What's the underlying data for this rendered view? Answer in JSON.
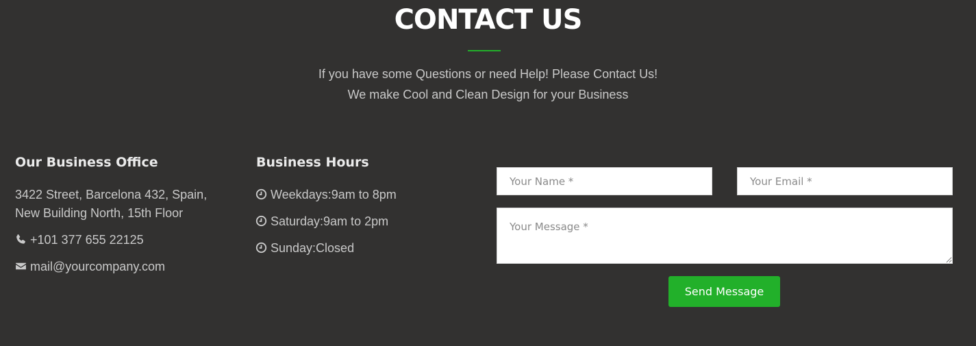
{
  "header": {
    "title": "CONTACT US",
    "subtitle_line1": "If you have some Questions or need Help! Please Contact Us!",
    "subtitle_line2": "We make Cool and Clean Design for your Business"
  },
  "office": {
    "heading": "Our Business Office",
    "address_line1": "3422 Street, Barcelona 432, Spain,",
    "address_line2": "New Building North, 15th Floor",
    "phone": "+101 377 655 22125",
    "email": "mail@yourcompany.com",
    "phone_icon": "phone-icon",
    "email_icon": "envelope-icon"
  },
  "hours": {
    "heading": "Business Hours",
    "items": [
      {
        "label": "Weekdays:9am to 8pm",
        "icon": "clock-icon"
      },
      {
        "label": "Saturday:9am to 2pm",
        "icon": "clock-icon"
      },
      {
        "label": "Sunday:Closed",
        "icon": "clock-icon"
      }
    ]
  },
  "form": {
    "name_placeholder": "Your Name *",
    "email_placeholder": "Your Email *",
    "message_placeholder": "Your Message *",
    "submit_label": "Send Message"
  },
  "colors": {
    "background": "#323130",
    "accent": "#22b02a",
    "heading": "#ffffff",
    "text": "#c9c9c9"
  }
}
